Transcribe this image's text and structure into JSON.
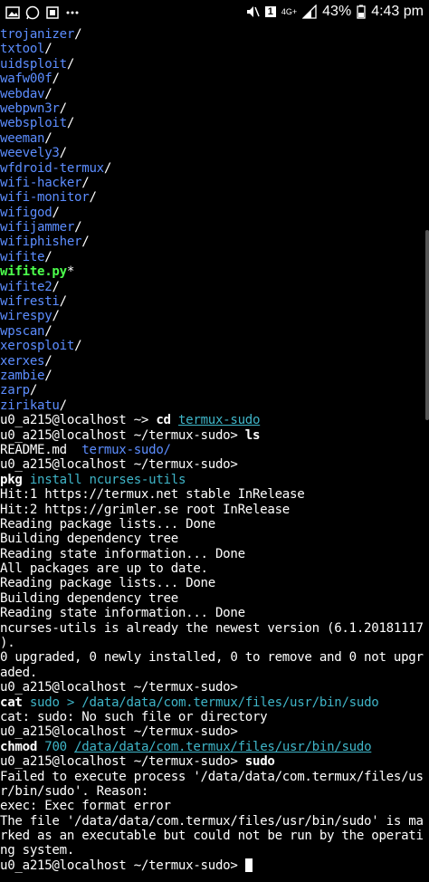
{
  "status_bar": {
    "battery_percent": "43%",
    "time": "4:43 pm",
    "network": "4G+",
    "sim": "1"
  },
  "dirs": [
    "trojanizer",
    "txtool",
    "uidsploit",
    "wafw00f",
    "webdav",
    "webpwn3r",
    "websploit",
    "weeman",
    "weevely3",
    "wfdroid-termux",
    "wifi-hacker",
    "wifi-monitor",
    "wifigod",
    "wifijammer",
    "wifiphisher",
    "wifite"
  ],
  "exec_file": "wifite.py",
  "dirs2": [
    "wifite2",
    "wifresti",
    "wirespy",
    "wpscan",
    "xerosploit",
    "xerxes",
    "zambie",
    "zarp",
    "zirikatu"
  ],
  "prompt_home": "u0_a215@localhost ~> ",
  "cmd_cd": "cd",
  "cmd_cd_arg": "termux-sudo",
  "prompt_sudo": "u0_a215@localhost ~/termux-sudo> ",
  "cmd_ls": "ls",
  "ls_readme": "README.md",
  "ls_dir": "termux-sudo/",
  "cmd_pkg": "pkg",
  "cmd_pkg_args": "install ncurses-utils",
  "pkg_output": [
    "Hit:1 https://termux.net stable InRelease",
    "Hit:2 https://grimler.se root InRelease",
    "Reading package lists... Done",
    "Building dependency tree",
    "Reading state information... Done",
    "All packages are up to date.",
    "Reading package lists... Done",
    "Building dependency tree",
    "Reading state information... Done",
    "ncurses-utils is already the newest version (6.1.20181117",
    ").",
    "0 upgraded, 0 newly installed, 0 to remove and 0 not upgr",
    "aded."
  ],
  "cmd_cat": "cat",
  "cmd_cat_args": "sudo > /data/data/com.termux/files/usr/bin/sudo",
  "cat_error": "cat: sudo: No such file or directory",
  "cmd_chmod": "chmod",
  "cmd_chmod_mode": "700",
  "cmd_chmod_path": "/data/data/com.termux/files/usr/bin/sudo",
  "cmd_sudo": "sudo",
  "sudo_output": [
    "Failed to execute process '/data/data/com.termux/files/us",
    "r/bin/sudo'. Reason:",
    "exec: Exec format error",
    "The file '/data/data/com.termux/files/usr/bin/sudo' is ma",
    "rked as an executable but could not be run by the operati",
    "ng system."
  ]
}
